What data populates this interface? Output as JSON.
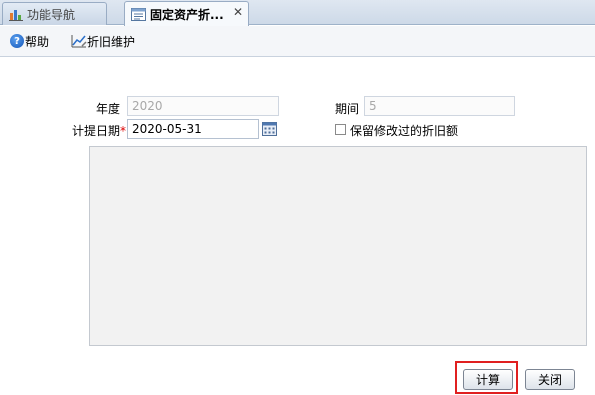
{
  "tabs": [
    {
      "label": "功能导航",
      "active": false
    },
    {
      "label": "固定资产折...",
      "active": true,
      "close": "✕"
    }
  ],
  "toolbar": {
    "help_label": "帮助",
    "depr_label": "折旧维护"
  },
  "form": {
    "year_label": "年度",
    "year_value": "2020",
    "period_label": "期间",
    "period_value": "5",
    "date_label": "计提日期",
    "required_mark": "*",
    "date_value": "2020-05-31",
    "keep_label": "保留修改过的折旧额",
    "keep_checked": false
  },
  "buttons": {
    "calc_label": "计算",
    "close_label": "关闭"
  },
  "colors": {
    "tabstrip_bg": "#cdd9e8",
    "highlight": "#e02020",
    "required": "#dd0000"
  }
}
